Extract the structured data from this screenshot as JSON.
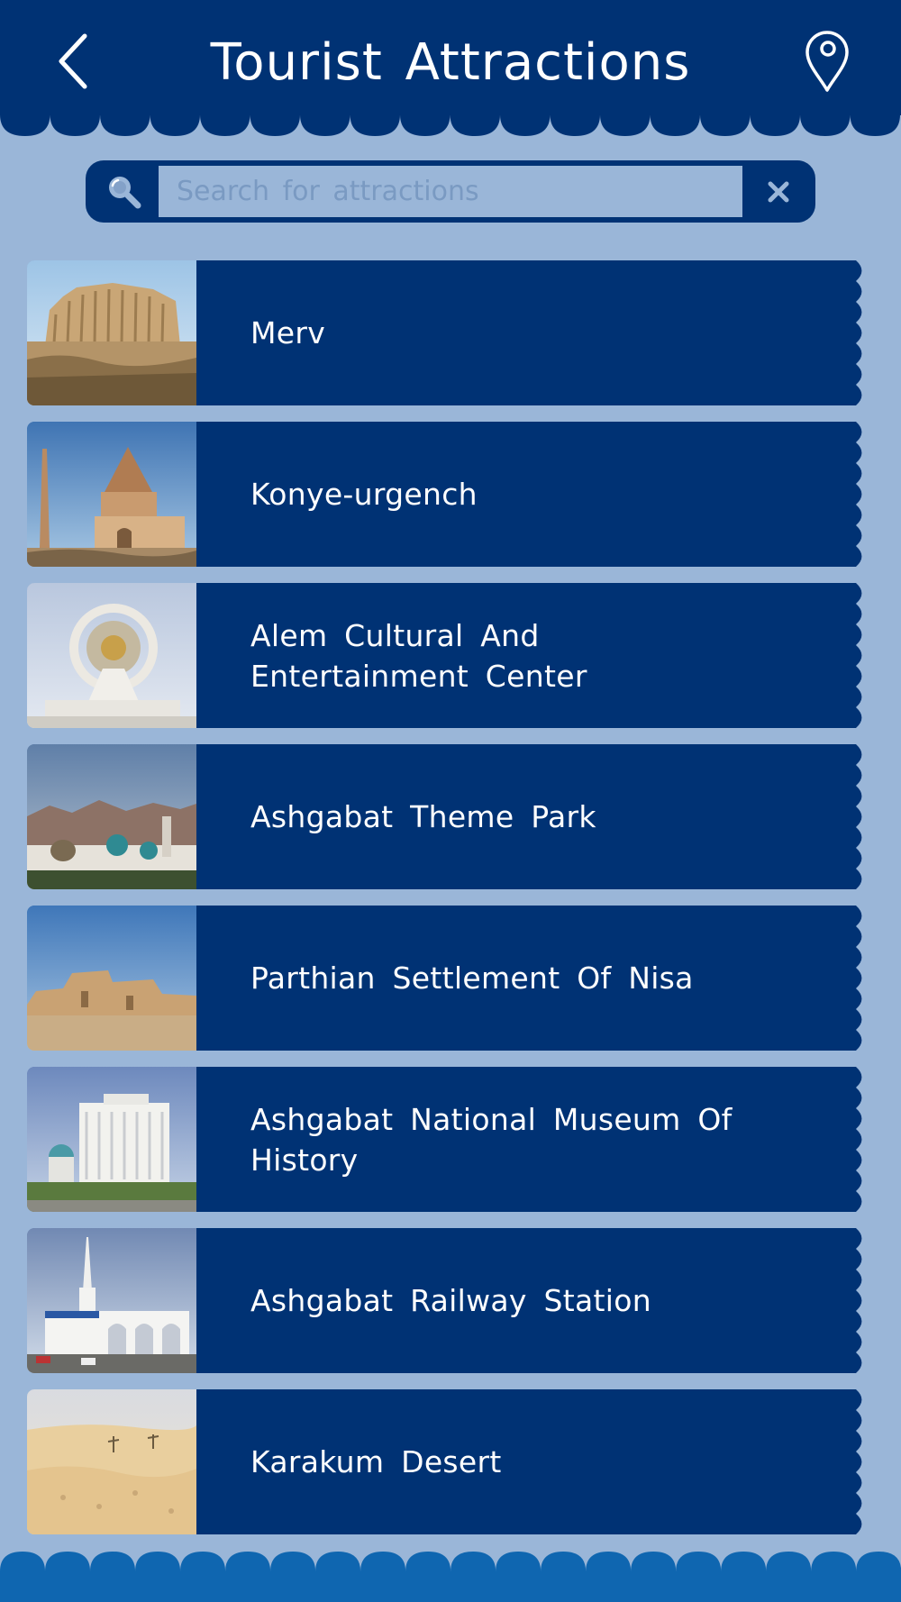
{
  "header": {
    "title": "Tourist Attractions",
    "back_icon": "chevron-left-icon",
    "location_icon": "map-pin-icon"
  },
  "search": {
    "placeholder": "Search for attractions",
    "value": "",
    "search_icon": "search-icon",
    "clear_icon": "close-icon"
  },
  "attractions": [
    {
      "name": "Merv",
      "image": "merv-photo"
    },
    {
      "name": "Konye-urgench",
      "image": "konye-urgench-photo"
    },
    {
      "name": "Alem Cultural And Entertainment Center",
      "line1": "Alem Cultural And",
      "line2": "Entertainment Center",
      "image": "alem-center-photo"
    },
    {
      "name": "Ashgabat Theme Park",
      "image": "theme-park-photo"
    },
    {
      "name": "Parthian Settlement Of Nisa",
      "image": "nisa-photo"
    },
    {
      "name": "Ashgabat National Museum Of History",
      "image": "museum-photo"
    },
    {
      "name": "Ashgabat Railway Station",
      "image": "railway-station-photo"
    },
    {
      "name": "Karakum Desert",
      "image": "karakum-desert-photo"
    }
  ],
  "colors": {
    "primary": "#003274",
    "background": "#9ab6d8",
    "footer": "#0f66b0",
    "text": "#ffffff"
  }
}
